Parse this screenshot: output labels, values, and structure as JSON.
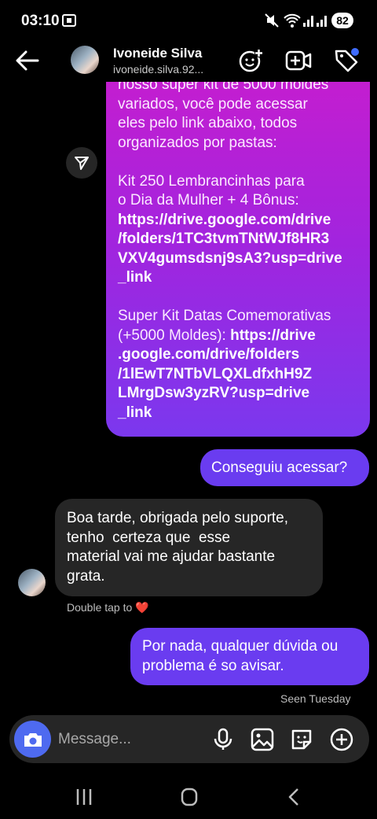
{
  "status_bar": {
    "time": "03:10",
    "battery": "82"
  },
  "header": {
    "name": "Ivoneide Silva",
    "handle": "ivoneide.silva.92..."
  },
  "messages": {
    "shared_lines": [
      "nosso super kit de 5000 moldes",
      "variados, você pode acessar",
      "eles pelo link abaixo, todos",
      "organizados por pastas:",
      "",
      "Kit 250 Lembrancinhas para",
      "o Dia da Mulher + 4 Bônus:",
      "https://drive.google.com/drive",
      "/folders/1TC3tvmTNtWJf8HR3",
      "VXV4gumsdsnj9sA3?usp=drive",
      "_link",
      "",
      "Super Kit Datas Comemorativas",
      "(+5000 Moldes): ",
      ".google.com/drive/folders",
      "/1lEwT7NTbVLQXLdfxhH9Z",
      "LMrgDsw3yzRV?usp=drive",
      "_link"
    ],
    "link_inline": "https://drive",
    "sent_1": "Conseguiu acessar?",
    "received_lines": [
      "Boa tarde, obrigada pelo suporte,",
      "tenho  certeza que  esse",
      "material vai me ajudar bastante",
      "grata."
    ],
    "double_tap": "Double tap to ❤️",
    "sent_2_lines": [
      "Por nada, qualquer dúvida ou",
      "problema é so avisar."
    ],
    "seen": "Seen Tuesday"
  },
  "composer": {
    "placeholder": "Message..."
  },
  "icons": {
    "back": "arrow-left-icon",
    "add_emoji": "emoji-add-icon",
    "video_call": "video-add-icon",
    "tag": "tag-icon",
    "share": "share-send-icon",
    "camera": "camera-icon",
    "mic": "microphone-icon",
    "gallery": "image-icon",
    "sticker": "sticker-icon",
    "plus": "plus-circle-icon"
  },
  "colors": {
    "accent_sent": "#6a3cf0",
    "camera_button": "#4e6af0",
    "received_bg": "#262626",
    "tag_dot": "#3f6cff"
  }
}
